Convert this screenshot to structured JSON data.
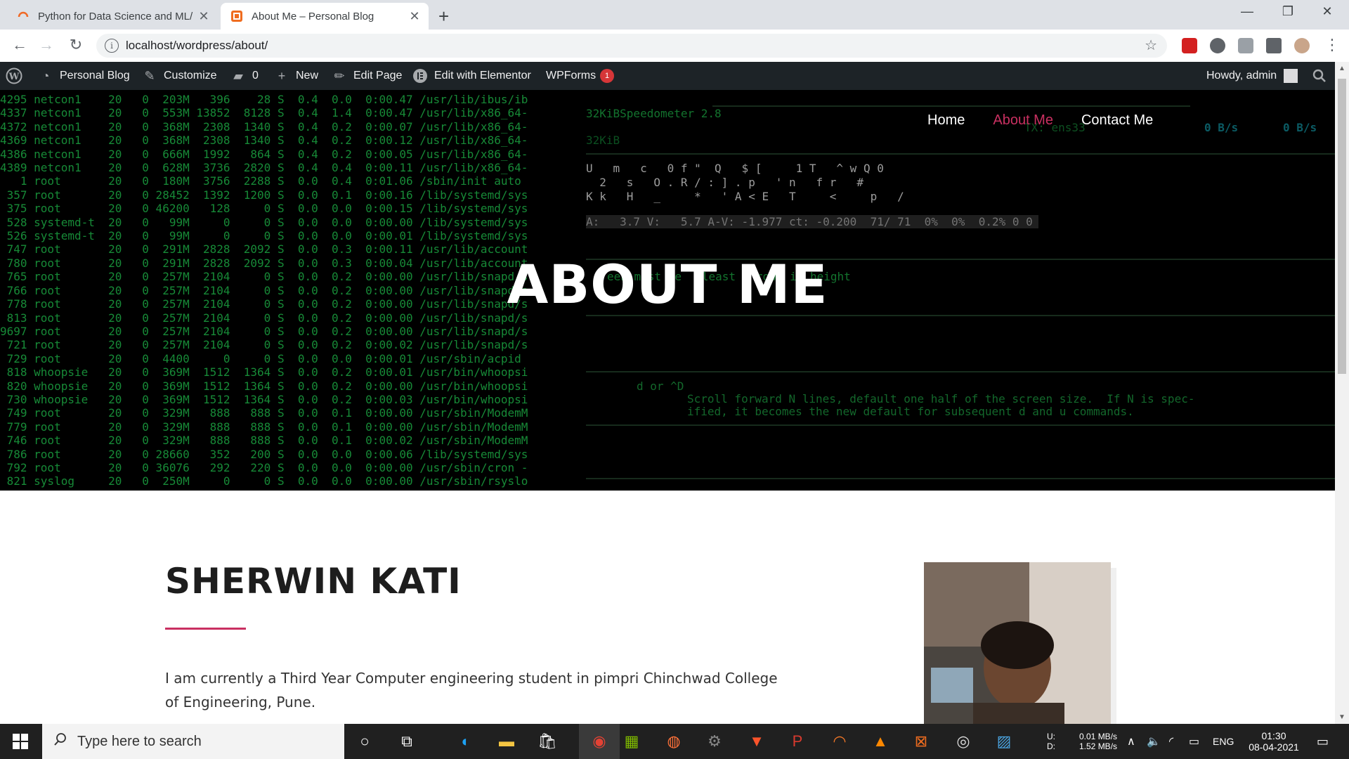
{
  "browser": {
    "tabs": [
      {
        "title": "Python for Data Science and ML/",
        "active": false
      },
      {
        "title": "About Me – Personal Blog",
        "active": true
      }
    ],
    "url": "localhost/wordpress/about/"
  },
  "adminbar": {
    "site": "Personal Blog",
    "customize": "Customize",
    "comments": "0",
    "new": "New",
    "edit_page": "Edit Page",
    "elementor": "Edit with Elementor",
    "wpforms": "WPForms",
    "wpforms_count": "1",
    "howdy": "Howdy, admin"
  },
  "site_nav": {
    "items": [
      {
        "label": "Home",
        "active": false
      },
      {
        "label": "About Me",
        "active": true
      },
      {
        "label": "Contact Me",
        "active": false
      }
    ],
    "active_color": "#c93061"
  },
  "hero": {
    "title": "ABOUT ME",
    "terminal_lines": [
      "4295 netcon1    20   0  203M   396    28 S  0.4  0.0  0:00.47 /usr/lib/ibus/ib",
      "4337 netcon1    20   0  553M 13852  8128 S  0.4  1.4  0:00.47 /usr/lib/x86_64-",
      "4372 netcon1    20   0  368M  2308  1340 S  0.4  0.2  0:00.07 /usr/lib/x86_64-",
      "4369 netcon1    20   0  368M  2308  1340 S  0.4  0.2  0:00.12 /usr/lib/x86_64-",
      "4386 netcon1    20   0  666M  1992   864 S  0.4  0.2  0:00.05 /usr/lib/x86_64-",
      "4389 netcon1    20   0  628M  3736  2820 S  0.4  0.4  0:00.11 /usr/lib/x86_64-",
      "   1 root       20   0  180M  3756  2288 S  0.0  0.4  0:01.06 /sbin/init auto",
      " 357 root       20   0 28452  1392  1200 S  0.0  0.1  0:00.16 /lib/systemd/sys",
      " 375 root       20   0 46200   128     0 S  0.0  0.0  0:00.15 /lib/systemd/sys",
      " 528 systemd-t  20   0   99M     0     0 S  0.0  0.0  0:00.00 /lib/systemd/sys",
      " 526 systemd-t  20   0   99M     0     0 S  0.0  0.0  0:00.01 /lib/systemd/sys",
      " 747 root       20   0  291M  2828  2092 S  0.0  0.3  0:00.11 /usr/lib/account",
      " 780 root       20   0  291M  2828  2092 S  0.0  0.3  0:00.04 /usr/lib/account",
      " 765 root       20   0  257M  2104     0 S  0.0  0.2  0:00.00 /usr/lib/snapd/s",
      " 766 root       20   0  257M  2104     0 S  0.0  0.2  0:00.00 /usr/lib/snapd/s",
      " 778 root       20   0  257M  2104     0 S  0.0  0.2  0:00.00 /usr/lib/snapd/s",
      " 813 root       20   0  257M  2104     0 S  0.0  0.2  0:00.00 /usr/lib/snapd/s",
      "9697 root       20   0  257M  2104     0 S  0.0  0.2  0:00.00 /usr/lib/snapd/s",
      " 721 root       20   0  257M  2104     0 S  0.0  0.2  0:00.02 /usr/lib/snapd/s",
      " 729 root       20   0  4400     0     0 S  0.0  0.0  0:00.01 /usr/sbin/acpid",
      " 818 whoopsie   20   0  369M  1512  1364 S  0.0  0.2  0:00.01 /usr/bin/whoopsi",
      " 820 whoopsie   20   0  369M  1512  1364 S  0.0  0.2  0:00.00 /usr/bin/whoopsi",
      " 730 whoopsie   20   0  369M  1512  1364 S  0.0  0.2  0:00.03 /usr/bin/whoopsi",
      " 749 root       20   0  329M   888   888 S  0.0  0.1  0:00.00 /usr/sbin/ModemM",
      " 779 root       20   0  329M   888   888 S  0.0  0.1  0:00.00 /usr/sbin/ModemM",
      " 746 root       20   0  329M   888   888 S  0.0  0.1  0:00.02 /usr/sbin/ModemM",
      " 786 root       20   0 28660   352   200 S  0.0  0.0  0:00.06 /lib/systemd/sys",
      " 792 root       20   0 36076   292   220 S  0.0  0.0  0:00.00 /usr/sbin/cron -",
      " 821 syslog     20   0  250M     0     0 S  0.0  0.0  0:00.00 /usr/sbin/rsyslo"
    ],
    "term2": {
      "speedometer": "32KiBSpeedometer 2.8",
      "kib": "32KiB",
      "tx": "TX: ens33",
      "rate1": "0 B/s",
      "rate2": "0 B/s",
      "row1": "U   m   c   0 f \"  Q   $ [     1 T   ^ w Q 0",
      "row2": "  2   s   O . R / : ] . p   ' n   f r   #",
      "row3": "K k   H   _     *   ' A < E   T     <     p   /",
      "status": "A:   3.7 V:   5.7 A-V: -1.977 ct: -0.200  71/ 71  0%  0%  0.2% 0 0",
      "lesshint": "een must be   least   rows in height",
      "help1": "d or ^D",
      "help2": "Scroll forward N lines, default one half of the screen size.  If N is spec-",
      "help3": "ified, it becomes the new default for subsequent d and u commands."
    }
  },
  "content": {
    "name": "SHERWIN KATI",
    "bio": "I am currently a Third Year Computer engineering student in pimpri Chinchwad College of Engineering, Pune."
  },
  "taskbar": {
    "search_placeholder": "Type here to search",
    "net_up_label": "U:",
    "net_down_label": "D:",
    "net_up": "0.01 MB/s",
    "net_down": "1.52 MB/s",
    "lang": "ENG",
    "time": "01:30",
    "date": "08-04-2021"
  }
}
